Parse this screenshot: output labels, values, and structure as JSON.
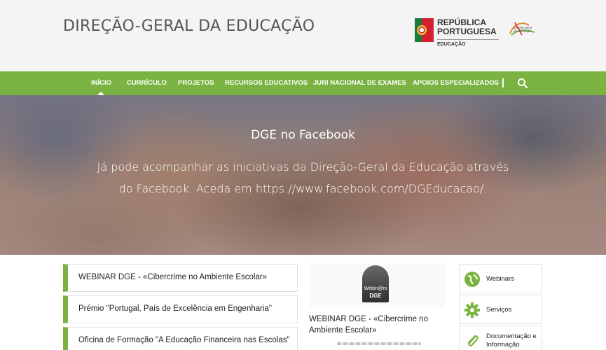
{
  "header": {
    "site_title": "DIREÇÃO-GERAL DA EDUCAÇÃO",
    "rp_line1": "REPÚBLICA",
    "rp_line2": "PORTUGUESA",
    "rp_line3": "EDUCAÇÃO",
    "dge_logo_text": "direção-geral da educação"
  },
  "nav": {
    "items": [
      {
        "label": "INÍCIO"
      },
      {
        "label": "CURRÍCULO"
      },
      {
        "label": "PROJETOS"
      },
      {
        "label": "RECURSOS EDUCATIVOS"
      },
      {
        "label": "JURI NACIONAL DE EXAMES"
      },
      {
        "label": "APOIOS ESPECIALIZADOS"
      }
    ],
    "active": "INÍCIO"
  },
  "hero": {
    "title": "DGE no Facebook",
    "text": "Já pode acompanhar as iniciativas da Direção-Geral da Educação através do Facebook. Aceda em https://www.facebook.com/DGEducacao/."
  },
  "news": [
    {
      "title": "WEBINAR DGE - «Cibercrime no Ambiente Escolar»"
    },
    {
      "title": "Prémio \"Portugal, País de Excelência em Engenharia\""
    },
    {
      "title": "Oficina de Formação \"A Educação Financeira nas Escolas\""
    }
  ],
  "feature": {
    "image_line1": "Webin@rs",
    "image_line2": "DGE",
    "title": "WEBINAR DGE - «Cibercrime no Ambiente Escolar»"
  },
  "services": [
    {
      "label": "Webinars",
      "icon": "globe-icon"
    },
    {
      "label": "Serviços",
      "icon": "gear-icon"
    },
    {
      "label": "Documentação e Informação",
      "icon": "paperclip-icon"
    }
  ],
  "colors": {
    "accent": "#7ab341",
    "header_bg": "#f4f4f4"
  }
}
